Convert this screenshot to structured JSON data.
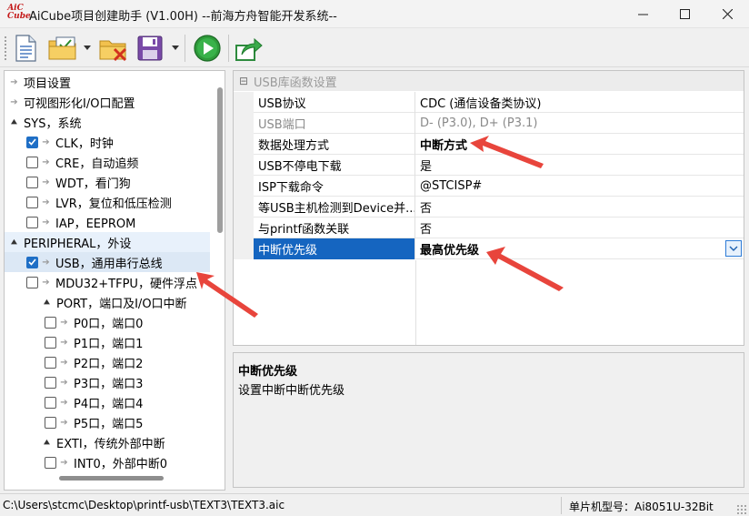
{
  "window": {
    "logo_top": "AiC",
    "logo_bottom": "Cube",
    "title": "AiCube项目创建助手 (V1.00H) --前海方舟智能开发系统--"
  },
  "toolbar": {
    "icons": [
      "new-document-icon",
      "open-project-icon",
      "close-project-icon",
      "save-icon",
      "run-icon",
      "export-icon"
    ]
  },
  "tree": {
    "items": [
      {
        "label": "项目设置",
        "kind": "arrow"
      },
      {
        "label": "可视图形化I/O口配置",
        "kind": "arrow"
      },
      {
        "label": "SYS，系统",
        "kind": "chevron"
      },
      {
        "label": "CLK，时钟",
        "kind": "check",
        "checked": true
      },
      {
        "label": "CRE，自动追频",
        "kind": "check",
        "checked": false
      },
      {
        "label": "WDT，看门狗",
        "kind": "check",
        "checked": false
      },
      {
        "label": "LVR，复位和低压检测",
        "kind": "check",
        "checked": false
      },
      {
        "label": "IAP，EEPROM",
        "kind": "check",
        "checked": false
      },
      {
        "label": "PERIPHERAL，外设",
        "kind": "chevron"
      },
      {
        "label": "USB，通用串行总线",
        "kind": "check",
        "checked": true
      },
      {
        "label": "MDU32+TFPU，硬件浮点",
        "kind": "check",
        "checked": false
      },
      {
        "label": "PORT，端口及I/O口中断",
        "kind": "chevron"
      },
      {
        "label": "P0口，端口0",
        "kind": "check",
        "checked": false
      },
      {
        "label": "P1口，端口1",
        "kind": "check",
        "checked": false
      },
      {
        "label": "P2口，端口2",
        "kind": "check",
        "checked": false
      },
      {
        "label": "P3口，端口3",
        "kind": "check",
        "checked": false
      },
      {
        "label": "P4口，端口4",
        "kind": "check",
        "checked": false
      },
      {
        "label": "P5口，端口5",
        "kind": "check",
        "checked": false
      },
      {
        "label": "EXTI，传统外部中断",
        "kind": "chevron"
      },
      {
        "label": "INT0，外部中断0",
        "kind": "check",
        "checked": false
      }
    ]
  },
  "props": {
    "category": "USB库函数设置",
    "rows": [
      {
        "name": "USB协议",
        "value": "CDC (通信设备类协议)"
      },
      {
        "name": "USB端口",
        "value": "D- (P3.0), D+ (P3.1)"
      },
      {
        "name": "数据处理方式",
        "value": "中断方式"
      },
      {
        "name": "USB不停电下载",
        "value": "是"
      },
      {
        "name": "ISP下载命令",
        "value": "@STCISP#"
      },
      {
        "name": "等USB主机检测到Device并...",
        "value": "否"
      },
      {
        "name": "与printf函数关联",
        "value": "否"
      },
      {
        "name": "中断优先级",
        "value": "最高优先级"
      }
    ]
  },
  "description": {
    "title": "中断优先级",
    "text": "设置中断中断优先级"
  },
  "status": {
    "path": "C:\\Users\\stcmc\\Desktop\\printf-usb\\TEXT3\\TEXT3.aic",
    "mcu": "单片机型号：Ai8051U-32Bit"
  },
  "colors": {
    "accent": "#1565c0",
    "annotation": "#e8453c"
  }
}
